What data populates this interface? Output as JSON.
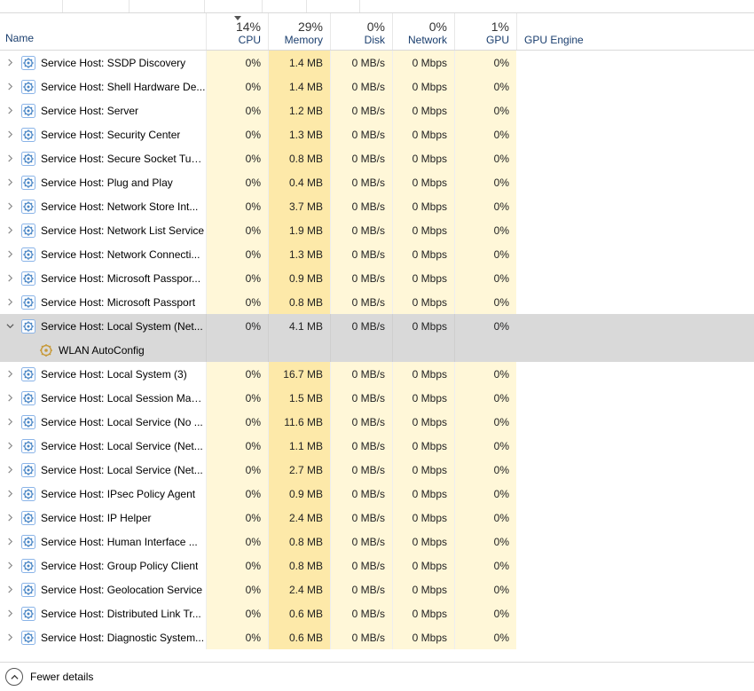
{
  "header": {
    "name_label": "Name",
    "cpu": {
      "pct": "14%",
      "label": "CPU"
    },
    "memory": {
      "pct": "29%",
      "label": "Memory"
    },
    "disk": {
      "pct": "0%",
      "label": "Disk"
    },
    "network": {
      "pct": "0%",
      "label": "Network"
    },
    "gpu": {
      "pct": "1%",
      "label": "GPU"
    },
    "gpu_engine_label": "GPU Engine"
  },
  "footer": {
    "fewer_details": "Fewer details"
  },
  "rows": [
    {
      "expander": "right",
      "icon": "gear",
      "name": "Service Host: SSDP Discovery",
      "cpu": "0%",
      "mem": "1.4 MB",
      "disk": "0 MB/s",
      "net": "0 Mbps",
      "gpu": "0%"
    },
    {
      "expander": "right",
      "icon": "gear",
      "name": "Service Host: Shell Hardware De...",
      "cpu": "0%",
      "mem": "1.4 MB",
      "disk": "0 MB/s",
      "net": "0 Mbps",
      "gpu": "0%"
    },
    {
      "expander": "right",
      "icon": "gear",
      "name": "Service Host: Server",
      "cpu": "0%",
      "mem": "1.2 MB",
      "disk": "0 MB/s",
      "net": "0 Mbps",
      "gpu": "0%"
    },
    {
      "expander": "right",
      "icon": "gear",
      "name": "Service Host: Security Center",
      "cpu": "0%",
      "mem": "1.3 MB",
      "disk": "0 MB/s",
      "net": "0 Mbps",
      "gpu": "0%"
    },
    {
      "expander": "right",
      "icon": "gear",
      "name": "Service Host: Secure Socket Tun...",
      "cpu": "0%",
      "mem": "0.8 MB",
      "disk": "0 MB/s",
      "net": "0 Mbps",
      "gpu": "0%"
    },
    {
      "expander": "right",
      "icon": "gear",
      "name": "Service Host: Plug and Play",
      "cpu": "0%",
      "mem": "0.4 MB",
      "disk": "0 MB/s",
      "net": "0 Mbps",
      "gpu": "0%"
    },
    {
      "expander": "right",
      "icon": "gear",
      "name": "Service Host: Network Store Int...",
      "cpu": "0%",
      "mem": "3.7 MB",
      "disk": "0 MB/s",
      "net": "0 Mbps",
      "gpu": "0%"
    },
    {
      "expander": "right",
      "icon": "gear",
      "name": "Service Host: Network List Service",
      "cpu": "0%",
      "mem": "1.9 MB",
      "disk": "0 MB/s",
      "net": "0 Mbps",
      "gpu": "0%"
    },
    {
      "expander": "right",
      "icon": "gear",
      "name": "Service Host: Network Connecti...",
      "cpu": "0%",
      "mem": "1.3 MB",
      "disk": "0 MB/s",
      "net": "0 Mbps",
      "gpu": "0%"
    },
    {
      "expander": "right",
      "icon": "gear",
      "name": "Service Host: Microsoft Passpor...",
      "cpu": "0%",
      "mem": "0.9 MB",
      "disk": "0 MB/s",
      "net": "0 Mbps",
      "gpu": "0%"
    },
    {
      "expander": "right",
      "icon": "gear",
      "name": "Service Host: Microsoft Passport",
      "cpu": "0%",
      "mem": "0.8 MB",
      "disk": "0 MB/s",
      "net": "0 Mbps",
      "gpu": "0%"
    },
    {
      "expander": "down",
      "icon": "gear",
      "name": "Service Host: Local System (Net...",
      "cpu": "0%",
      "mem": "4.1 MB",
      "disk": "0 MB/s",
      "net": "0 Mbps",
      "gpu": "0%",
      "selected": true
    },
    {
      "expander": "none",
      "icon": "svc",
      "name": "WLAN AutoConfig",
      "child": true,
      "selected": true
    },
    {
      "expander": "right",
      "icon": "gear",
      "name": "Service Host: Local System (3)",
      "cpu": "0%",
      "mem": "16.7 MB",
      "disk": "0 MB/s",
      "net": "0 Mbps",
      "gpu": "0%"
    },
    {
      "expander": "right",
      "icon": "gear",
      "name": "Service Host: Local Session Man...",
      "cpu": "0%",
      "mem": "1.5 MB",
      "disk": "0 MB/s",
      "net": "0 Mbps",
      "gpu": "0%"
    },
    {
      "expander": "right",
      "icon": "gear",
      "name": "Service Host: Local Service (No ...",
      "cpu": "0%",
      "mem": "11.6 MB",
      "disk": "0 MB/s",
      "net": "0 Mbps",
      "gpu": "0%"
    },
    {
      "expander": "right",
      "icon": "gear",
      "name": "Service Host: Local Service (Net...",
      "cpu": "0%",
      "mem": "1.1 MB",
      "disk": "0 MB/s",
      "net": "0 Mbps",
      "gpu": "0%"
    },
    {
      "expander": "right",
      "icon": "gear",
      "name": "Service Host: Local Service (Net...",
      "cpu": "0%",
      "mem": "2.7 MB",
      "disk": "0 MB/s",
      "net": "0 Mbps",
      "gpu": "0%"
    },
    {
      "expander": "right",
      "icon": "gear",
      "name": "Service Host: IPsec Policy Agent",
      "cpu": "0%",
      "mem": "0.9 MB",
      "disk": "0 MB/s",
      "net": "0 Mbps",
      "gpu": "0%"
    },
    {
      "expander": "right",
      "icon": "gear",
      "name": "Service Host: IP Helper",
      "cpu": "0%",
      "mem": "2.4 MB",
      "disk": "0 MB/s",
      "net": "0 Mbps",
      "gpu": "0%"
    },
    {
      "expander": "right",
      "icon": "gear",
      "name": "Service Host: Human Interface ...",
      "cpu": "0%",
      "mem": "0.8 MB",
      "disk": "0 MB/s",
      "net": "0 Mbps",
      "gpu": "0%"
    },
    {
      "expander": "right",
      "icon": "gear",
      "name": "Service Host: Group Policy Client",
      "cpu": "0%",
      "mem": "0.8 MB",
      "disk": "0 MB/s",
      "net": "0 Mbps",
      "gpu": "0%"
    },
    {
      "expander": "right",
      "icon": "gear",
      "name": "Service Host: Geolocation Service",
      "cpu": "0%",
      "mem": "2.4 MB",
      "disk": "0 MB/s",
      "net": "0 Mbps",
      "gpu": "0%"
    },
    {
      "expander": "right",
      "icon": "gear",
      "name": "Service Host: Distributed Link Tr...",
      "cpu": "0%",
      "mem": "0.6 MB",
      "disk": "0 MB/s",
      "net": "0 Mbps",
      "gpu": "0%"
    },
    {
      "expander": "right",
      "icon": "gear",
      "name": "Service Host: Diagnostic System...",
      "cpu": "0%",
      "mem": "0.6 MB",
      "disk": "0 MB/s",
      "net": "0 Mbps",
      "gpu": "0%"
    }
  ]
}
